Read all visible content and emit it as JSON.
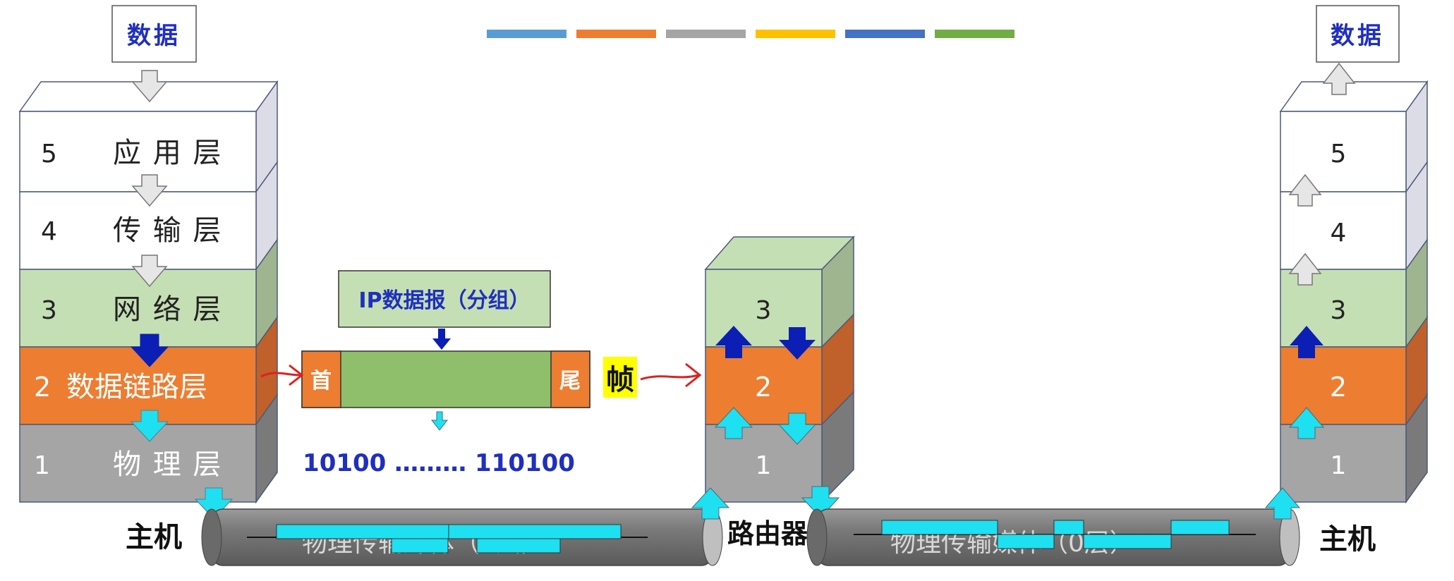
{
  "data_box": {
    "left": "数据",
    "right": "数据"
  },
  "legend_swatches": [
    "#5b9bd5",
    "#ed7d31",
    "#a5a5a5",
    "#ffc000",
    "#4472c4",
    "#70ad47"
  ],
  "left_host": {
    "label": "主机",
    "layers": [
      {
        "num": "5",
        "name": "应 用 层"
      },
      {
        "num": "4",
        "name": "传 输 层"
      },
      {
        "num": "3",
        "name": "网 络 层"
      },
      {
        "num": "2",
        "name": "数据链路层"
      },
      {
        "num": "1",
        "name": "物 理 层"
      }
    ]
  },
  "router": {
    "label": "路由器",
    "layers": [
      "3",
      "2",
      "1"
    ]
  },
  "right_host": {
    "label": "主机",
    "layers": [
      "5",
      "4",
      "3",
      "2",
      "1"
    ]
  },
  "frame": {
    "ip_label": "IP数据报（分组）",
    "head": "首",
    "tail": "尾",
    "frame_label": "帧",
    "bits": "10100 ……… 110100"
  },
  "media": {
    "left": "物理传输媒体（0层）",
    "right": "物理传输媒体（0层）"
  },
  "colors": {
    "layer5": "#ffffff",
    "layer4": "#ffffff",
    "layer3": "#c5dfb4",
    "layer2": "#ed7d31",
    "layer1": "#a5a5a5",
    "blue_text": "#1f2fbf",
    "arrow_cyan": "#1ee0f0",
    "arrow_dark": "#0b1fb5",
    "frame_green": "#8fbf6a",
    "highlight": "#ffff00"
  }
}
